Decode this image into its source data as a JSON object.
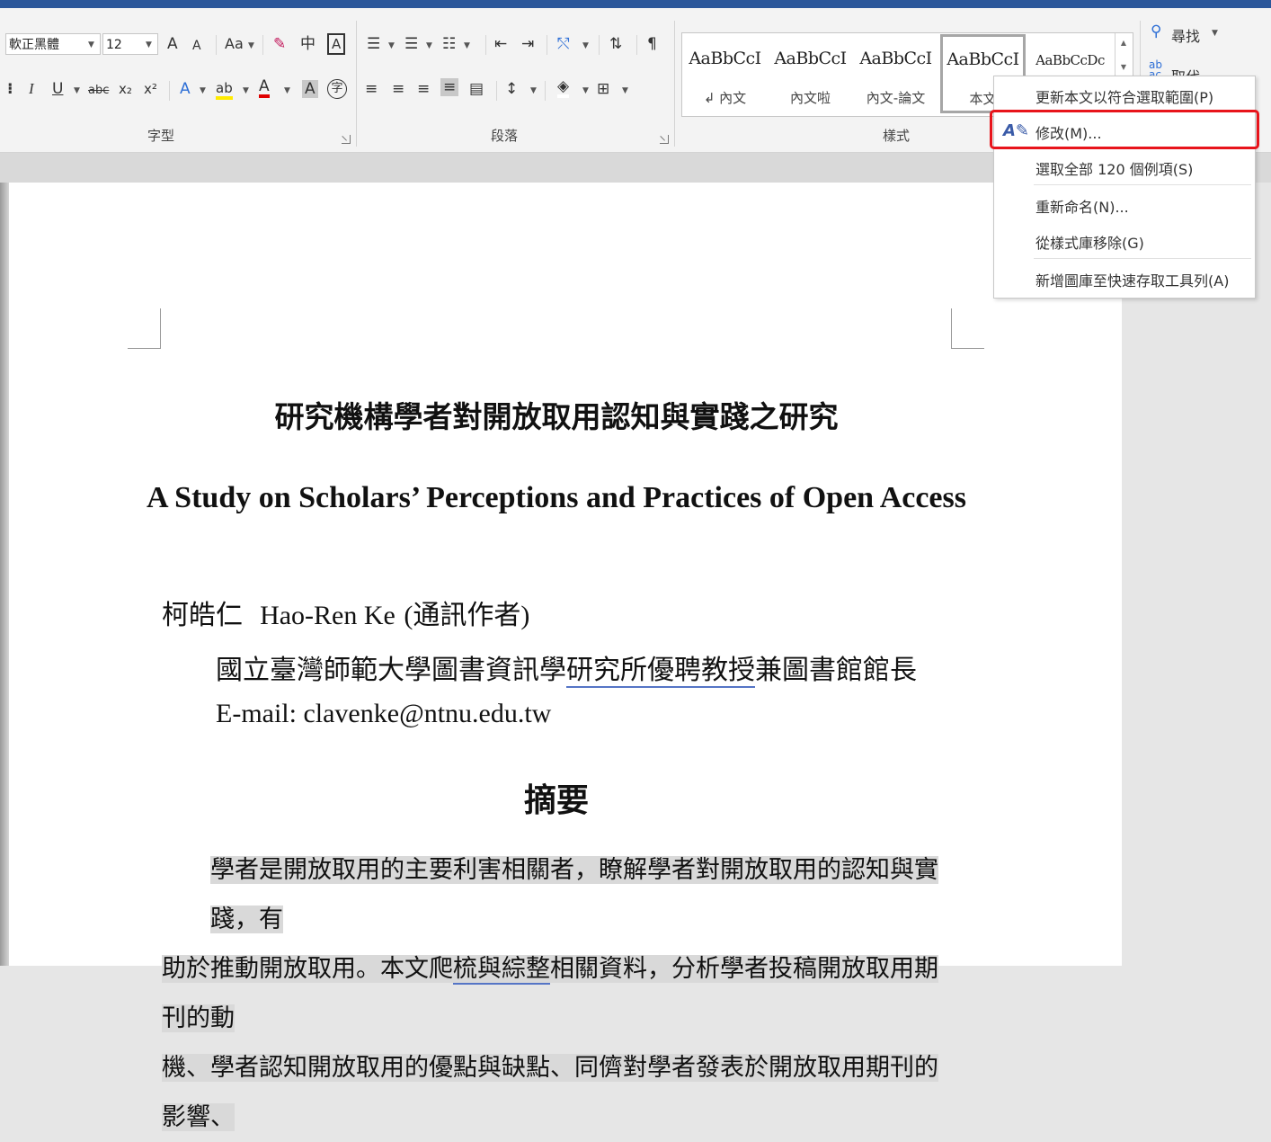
{
  "ribbon": {
    "font": {
      "name_value": "軟正黑體",
      "size_value": "12",
      "grow_label": "A",
      "shrink_label": "A",
      "case_label": "Aa",
      "phonetic_label": "中",
      "border_char_label": "A",
      "bold_label": "B",
      "italic_label": "I",
      "underline_label": "U",
      "strike_label": "abc",
      "sub_label": "x₂",
      "sup_label": "x²",
      "effects_label": "A",
      "highlight_label": "ab",
      "color_label": "A",
      "shade_label": "A",
      "enclose_label": "字",
      "group_label": "字型"
    },
    "paragraph": {
      "group_label": "段落"
    },
    "styles": {
      "group_label": "樣式",
      "items": [
        {
          "sample": "AaBbCcI",
          "name": "↲ 內文"
        },
        {
          "sample": "AaBbCcI",
          "name": "內文啦"
        },
        {
          "sample": "AaBbCcI",
          "name": "內文-論文"
        },
        {
          "sample": "AaBbCcI",
          "name": "本文"
        },
        {
          "sample": "AaBbCcDc",
          "name": ""
        }
      ]
    },
    "editing": {
      "find_label": "尋找",
      "replace_label": "取代"
    }
  },
  "context_menu": {
    "items": [
      {
        "label": "更新本文以符合選取範圍(P)"
      },
      {
        "label": "修改(M)..."
      },
      {
        "label": "選取全部 120 個例項(S)"
      },
      {
        "label": "重新命名(N)..."
      },
      {
        "label": "從樣式庫移除(G)"
      },
      {
        "label": "新增圖庫至快速存取工具列(A)"
      }
    ]
  },
  "document": {
    "title_zh": "研究機構學者對開放取用認知與實踐之研究",
    "title_en": "A Study on Scholars’ Perceptions and Practices of Open Access",
    "author_zh": "柯皓仁",
    "author_en": "Hao-Ren Ke",
    "author_note": "(通訊作者)",
    "affiliation_a": "國立臺灣師範大學圖書資訊學",
    "affiliation_b": "研究所優聘教授",
    "affiliation_c": "兼圖書館館長",
    "email": "E-mail: clavenke@ntnu.edu.tw",
    "abstract_heading": "摘要",
    "abstract_line1": "學者是開放取用的主要利害相關者，瞭解學者對開放取用的認知與實踐，有",
    "abstract_line2a": "助於推動開放取用。本文爬",
    "abstract_line2b": "梳與綜整",
    "abstract_line2c": "相關資料，分析學者投稿開放取用期刊的動",
    "abstract_line3": "機、學者認知開放取用的優點與缺點、同儕對學者發表於開放取用期刊的影響、"
  }
}
